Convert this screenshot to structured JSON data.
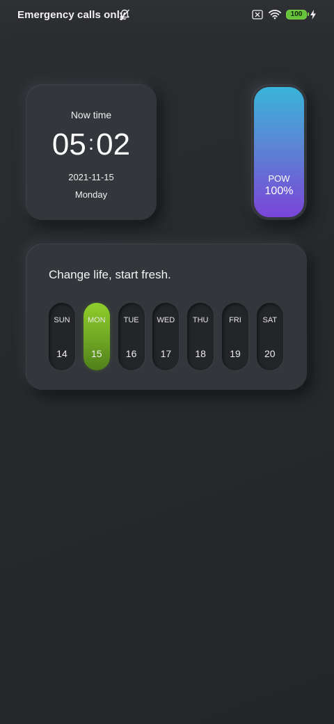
{
  "status_bar": {
    "carrier": "Emergency calls only",
    "battery_level": "100",
    "icons": [
      "bell-off-icon",
      "sim-x-icon",
      "wifi-icon",
      "battery-icon",
      "charging-bolt-icon"
    ],
    "battery_color": "#66c43a"
  },
  "time_widget": {
    "label": "Now time",
    "hours": "05",
    "separator": ":",
    "minutes": "02",
    "date": "2021-11-15",
    "weekday": "Monday"
  },
  "power_widget": {
    "label": "POW",
    "value": "100%",
    "level": 1.0,
    "gradient": [
      "#39b5da",
      "#7a45d8"
    ]
  },
  "week_widget": {
    "slogan": "Change life, start fresh.",
    "accent_color": "#8fcf2a",
    "days": [
      {
        "name": "SUN",
        "num": "14"
      },
      {
        "name": "MON",
        "num": "15",
        "active": true
      },
      {
        "name": "TUE",
        "num": "16"
      },
      {
        "name": "WED",
        "num": "17"
      },
      {
        "name": "THU",
        "num": "18"
      },
      {
        "name": "FRI",
        "num": "19"
      },
      {
        "name": "SAT",
        "num": "20"
      }
    ]
  }
}
